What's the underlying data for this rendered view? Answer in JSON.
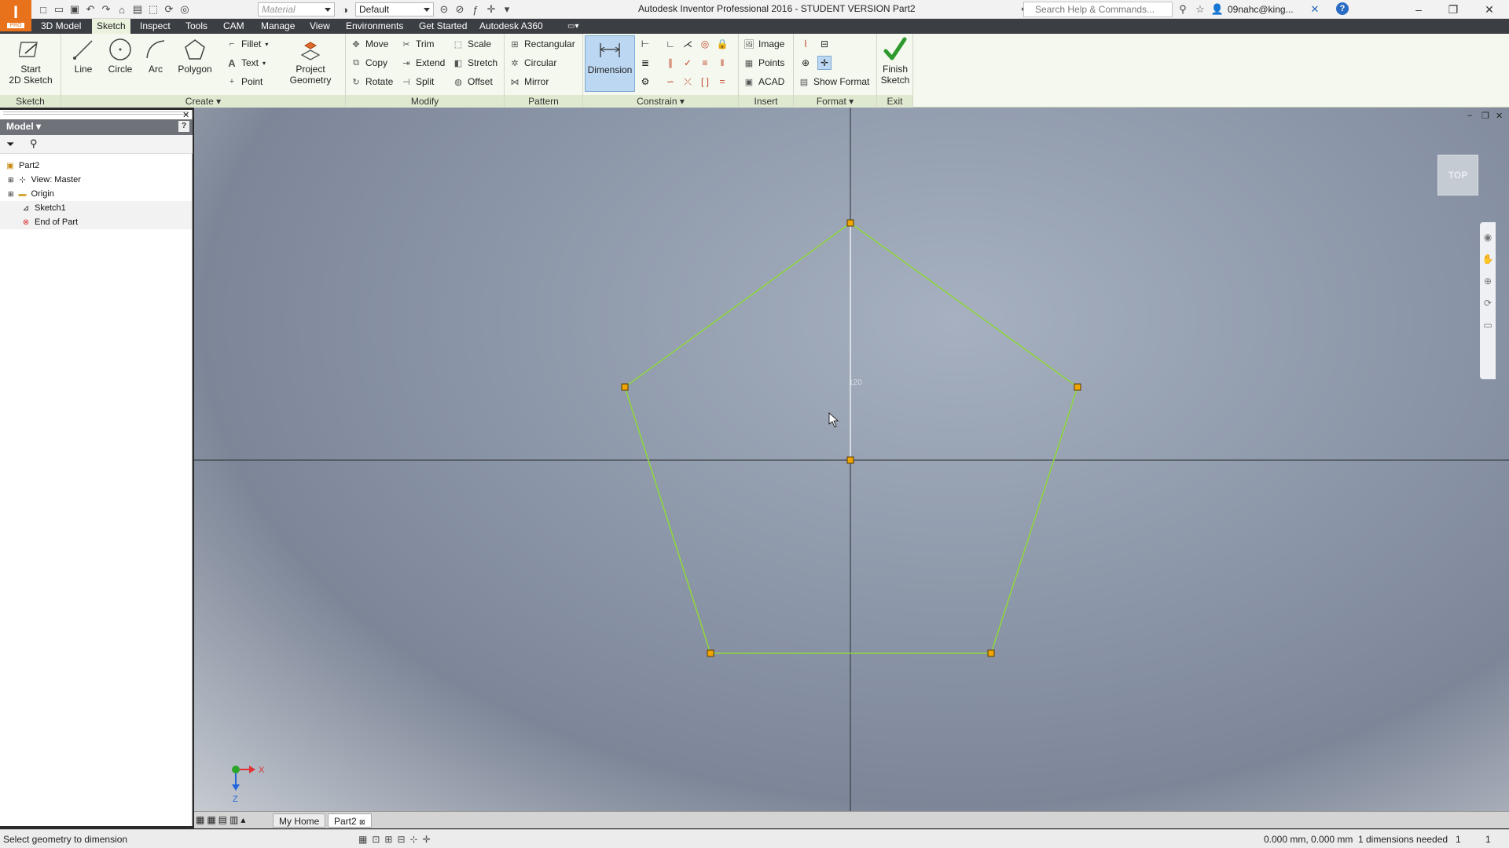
{
  "window": {
    "title": "Autodesk Inventor Professional 2016 - STUDENT VERSION   Part2",
    "app_letter": "I",
    "app_badge": "PRO",
    "material_placeholder": "Material",
    "appearance_value": "Default",
    "search_placeholder": "Search Help & Commands...",
    "user": "09nahc@king...",
    "help": "?"
  },
  "tabs": [
    "3D Model",
    "Sketch",
    "Inspect",
    "Tools",
    "CAM",
    "Manage",
    "View",
    "Environments",
    "Get Started",
    "Autodesk A360"
  ],
  "active_tab": "Sketch",
  "ribbon": {
    "sketch_panel": {
      "title": "Sketch",
      "start_2d_sketch_l1": "Start",
      "start_2d_sketch_l2": "2D Sketch"
    },
    "create_panel": {
      "title": "Create",
      "line": "Line",
      "circle": "Circle",
      "arc": "Arc",
      "polygon": "Polygon",
      "fillet": "Fillet",
      "text": "Text",
      "point": "Point",
      "project_l1": "Project",
      "project_l2": "Geometry"
    },
    "modify_panel": {
      "title": "Modify",
      "move": "Move",
      "copy": "Copy",
      "rotate": "Rotate",
      "trim": "Trim",
      "extend": "Extend",
      "split": "Split",
      "scale": "Scale",
      "stretch": "Stretch",
      "offset": "Offset"
    },
    "pattern_panel": {
      "title": "Pattern",
      "rectangular": "Rectangular",
      "circular": "Circular",
      "mirror": "Mirror"
    },
    "constrain_panel": {
      "title": "Constrain",
      "dimension": "Dimension"
    },
    "insert_panel": {
      "title": "Insert",
      "image": "Image",
      "points": "Points",
      "acad": "ACAD"
    },
    "format_panel": {
      "title": "Format",
      "show_format": "Show Format"
    },
    "exit_panel": {
      "title": "Exit",
      "finish_l1": "Finish",
      "finish_l2": "Sketch"
    }
  },
  "browser": {
    "header": "Model",
    "tree": [
      {
        "label": "Part2",
        "icon": "part-icon"
      },
      {
        "label": "View: Master",
        "icon": "view-icon"
      },
      {
        "label": "Origin",
        "icon": "folder-icon"
      },
      {
        "label": "Sketch1",
        "icon": "sketch-icon"
      },
      {
        "label": "End of Part",
        "icon": "end-of-part-icon"
      }
    ]
  },
  "viewport": {
    "viewcube_label": "TOP",
    "dimension_value": "120",
    "axis_x": "X",
    "axis_z": "Z",
    "sketch_color": "#8fd63f",
    "point_color": "#f0a500"
  },
  "doc_tabs": [
    "My Home",
    "Part2"
  ],
  "status": {
    "message": "Select geometry to dimension",
    "coords": "0.000 mm, 0.000 mm",
    "dims_needed": "1 dimensions needed",
    "count1": "1",
    "count2": "1"
  }
}
